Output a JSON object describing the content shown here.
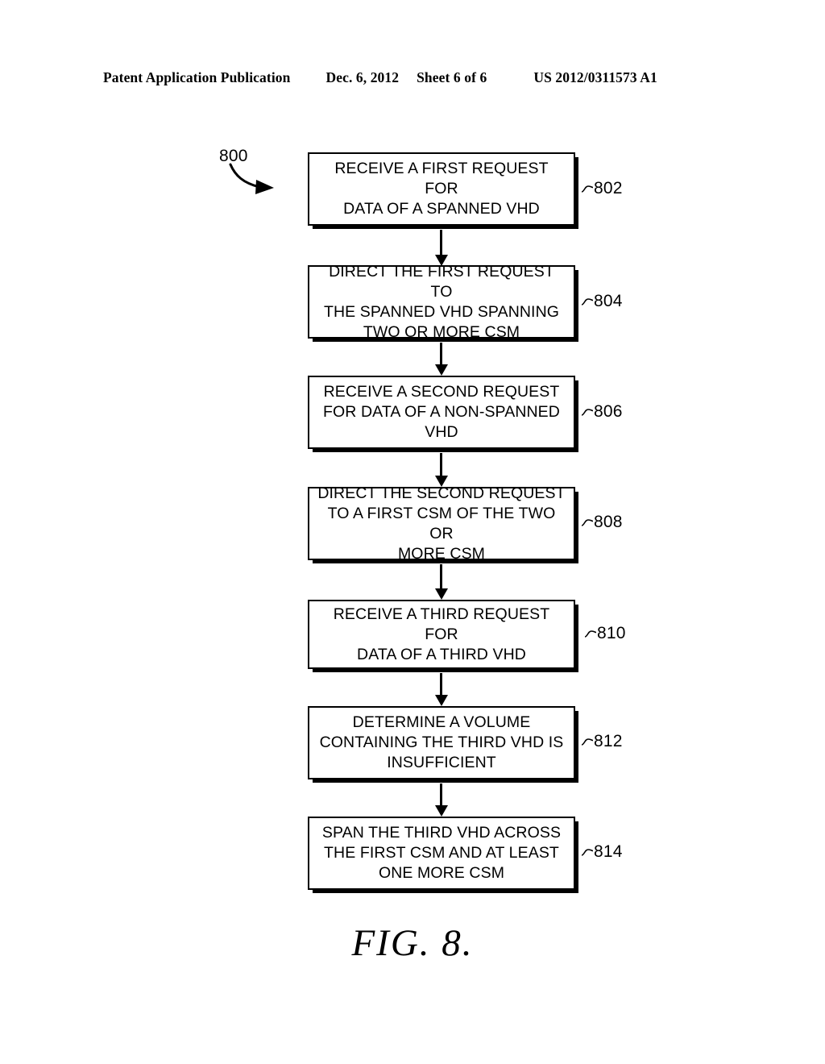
{
  "header": {
    "publication": "Patent Application Publication",
    "date": "Dec. 6, 2012",
    "sheet": "Sheet 6 of 6",
    "publication_number": "US 2012/0311573 A1"
  },
  "figure": {
    "diagram_label": "800",
    "caption": "FIG. 8.",
    "steps": [
      {
        "ref": "802",
        "text": "RECEIVE A FIRST REQUEST FOR\nDATA OF A SPANNED VHD"
      },
      {
        "ref": "804",
        "text": "DIRECT THE FIRST REQUEST TO\nTHE SPANNED VHD SPANNING\nTWO OR MORE CSM"
      },
      {
        "ref": "806",
        "text": "RECEIVE A SECOND REQUEST\nFOR DATA OF A NON-SPANNED\nVHD"
      },
      {
        "ref": "808",
        "text": "DIRECT THE SECOND REQUEST\nTO A FIRST CSM OF THE TWO OR\nMORE CSM"
      },
      {
        "ref": "810",
        "text": "RECEIVE A THIRD REQUEST FOR\nDATA OF A THIRD VHD"
      },
      {
        "ref": "812",
        "text": "DETERMINE A VOLUME\nCONTAINING THE THIRD VHD IS\nINSUFFICIENT"
      },
      {
        "ref": "814",
        "text": "SPAN THE THIRD  VHD ACROSS\nTHE FIRST CSM AND AT LEAST\nONE MORE CSM"
      }
    ]
  },
  "colors": {
    "ink": "#000000",
    "paper": "#ffffff"
  }
}
